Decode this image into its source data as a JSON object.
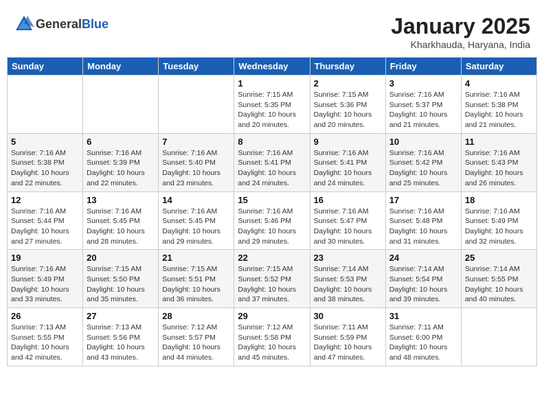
{
  "header": {
    "logo_general": "General",
    "logo_blue": "Blue",
    "title": "January 2025",
    "subtitle": "Kharkhauda, Haryana, India"
  },
  "days_of_week": [
    "Sunday",
    "Monday",
    "Tuesday",
    "Wednesday",
    "Thursday",
    "Friday",
    "Saturday"
  ],
  "weeks": [
    [
      {
        "day": "",
        "info": ""
      },
      {
        "day": "",
        "info": ""
      },
      {
        "day": "",
        "info": ""
      },
      {
        "day": "1",
        "info": "Sunrise: 7:15 AM\nSunset: 5:35 PM\nDaylight: 10 hours\nand 20 minutes."
      },
      {
        "day": "2",
        "info": "Sunrise: 7:15 AM\nSunset: 5:36 PM\nDaylight: 10 hours\nand 20 minutes."
      },
      {
        "day": "3",
        "info": "Sunrise: 7:16 AM\nSunset: 5:37 PM\nDaylight: 10 hours\nand 21 minutes."
      },
      {
        "day": "4",
        "info": "Sunrise: 7:16 AM\nSunset: 5:38 PM\nDaylight: 10 hours\nand 21 minutes."
      }
    ],
    [
      {
        "day": "5",
        "info": "Sunrise: 7:16 AM\nSunset: 5:38 PM\nDaylight: 10 hours\nand 22 minutes."
      },
      {
        "day": "6",
        "info": "Sunrise: 7:16 AM\nSunset: 5:39 PM\nDaylight: 10 hours\nand 22 minutes."
      },
      {
        "day": "7",
        "info": "Sunrise: 7:16 AM\nSunset: 5:40 PM\nDaylight: 10 hours\nand 23 minutes."
      },
      {
        "day": "8",
        "info": "Sunrise: 7:16 AM\nSunset: 5:41 PM\nDaylight: 10 hours\nand 24 minutes."
      },
      {
        "day": "9",
        "info": "Sunrise: 7:16 AM\nSunset: 5:41 PM\nDaylight: 10 hours\nand 24 minutes."
      },
      {
        "day": "10",
        "info": "Sunrise: 7:16 AM\nSunset: 5:42 PM\nDaylight: 10 hours\nand 25 minutes."
      },
      {
        "day": "11",
        "info": "Sunrise: 7:16 AM\nSunset: 5:43 PM\nDaylight: 10 hours\nand 26 minutes."
      }
    ],
    [
      {
        "day": "12",
        "info": "Sunrise: 7:16 AM\nSunset: 5:44 PM\nDaylight: 10 hours\nand 27 minutes."
      },
      {
        "day": "13",
        "info": "Sunrise: 7:16 AM\nSunset: 5:45 PM\nDaylight: 10 hours\nand 28 minutes."
      },
      {
        "day": "14",
        "info": "Sunrise: 7:16 AM\nSunset: 5:45 PM\nDaylight: 10 hours\nand 29 minutes."
      },
      {
        "day": "15",
        "info": "Sunrise: 7:16 AM\nSunset: 5:46 PM\nDaylight: 10 hours\nand 29 minutes."
      },
      {
        "day": "16",
        "info": "Sunrise: 7:16 AM\nSunset: 5:47 PM\nDaylight: 10 hours\nand 30 minutes."
      },
      {
        "day": "17",
        "info": "Sunrise: 7:16 AM\nSunset: 5:48 PM\nDaylight: 10 hours\nand 31 minutes."
      },
      {
        "day": "18",
        "info": "Sunrise: 7:16 AM\nSunset: 5:49 PM\nDaylight: 10 hours\nand 32 minutes."
      }
    ],
    [
      {
        "day": "19",
        "info": "Sunrise: 7:16 AM\nSunset: 5:49 PM\nDaylight: 10 hours\nand 33 minutes."
      },
      {
        "day": "20",
        "info": "Sunrise: 7:15 AM\nSunset: 5:50 PM\nDaylight: 10 hours\nand 35 minutes."
      },
      {
        "day": "21",
        "info": "Sunrise: 7:15 AM\nSunset: 5:51 PM\nDaylight: 10 hours\nand 36 minutes."
      },
      {
        "day": "22",
        "info": "Sunrise: 7:15 AM\nSunset: 5:52 PM\nDaylight: 10 hours\nand 37 minutes."
      },
      {
        "day": "23",
        "info": "Sunrise: 7:14 AM\nSunset: 5:53 PM\nDaylight: 10 hours\nand 38 minutes."
      },
      {
        "day": "24",
        "info": "Sunrise: 7:14 AM\nSunset: 5:54 PM\nDaylight: 10 hours\nand 39 minutes."
      },
      {
        "day": "25",
        "info": "Sunrise: 7:14 AM\nSunset: 5:55 PM\nDaylight: 10 hours\nand 40 minutes."
      }
    ],
    [
      {
        "day": "26",
        "info": "Sunrise: 7:13 AM\nSunset: 5:55 PM\nDaylight: 10 hours\nand 42 minutes."
      },
      {
        "day": "27",
        "info": "Sunrise: 7:13 AM\nSunset: 5:56 PM\nDaylight: 10 hours\nand 43 minutes."
      },
      {
        "day": "28",
        "info": "Sunrise: 7:12 AM\nSunset: 5:57 PM\nDaylight: 10 hours\nand 44 minutes."
      },
      {
        "day": "29",
        "info": "Sunrise: 7:12 AM\nSunset: 5:58 PM\nDaylight: 10 hours\nand 45 minutes."
      },
      {
        "day": "30",
        "info": "Sunrise: 7:11 AM\nSunset: 5:59 PM\nDaylight: 10 hours\nand 47 minutes."
      },
      {
        "day": "31",
        "info": "Sunrise: 7:11 AM\nSunset: 6:00 PM\nDaylight: 10 hours\nand 48 minutes."
      },
      {
        "day": "",
        "info": ""
      }
    ]
  ]
}
